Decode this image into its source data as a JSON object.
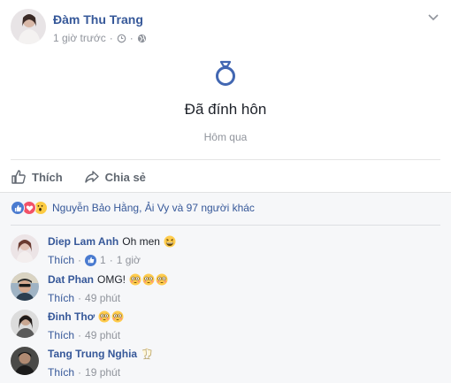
{
  "post": {
    "author": "Đàm Thu Trang",
    "time": "1 giờ trước",
    "time_separator": "·",
    "event_title": "Đã đính hôn",
    "event_date": "Hôm qua"
  },
  "actions": {
    "like_label": "Thích",
    "share_label": "Chia sẻ"
  },
  "reactions": {
    "summary": "Nguyễn Bảo Hằng, Ải Vy và 97 người khác",
    "types": [
      "like",
      "love",
      "wow"
    ]
  },
  "comments": [
    {
      "name": "Diep Lam Anh",
      "text": "Oh men",
      "emoji": [
        "grinning-squint"
      ],
      "like_label": "Thích",
      "like_count": "1",
      "sep": "·",
      "time": "1 giờ"
    },
    {
      "name": "Dat Phan",
      "text": "OMG!",
      "emoji": [
        "flushed",
        "flushed",
        "flushed"
      ],
      "like_label": "Thích",
      "sep": "·",
      "time": "49 phút"
    },
    {
      "name": "Đinh Thơ",
      "text": "",
      "emoji": [
        "flushed",
        "flushed"
      ],
      "like_label": "Thích",
      "sep": "·",
      "time": "49 phút"
    },
    {
      "name": "Tang Trung Nghia",
      "text": "",
      "emoji": [
        "clinking-glasses"
      ],
      "like_label": "Thích",
      "sep": "·",
      "time": "19 phút"
    }
  ],
  "colors": {
    "link_blue": "#365899",
    "meta_gray": "#90949c",
    "like_blue": "#4a7bd0",
    "love_red": "#f25268",
    "wow_yellow": "#fccb43",
    "feedback_bg": "#f6f7f9"
  },
  "icons": [
    "ring-icon",
    "clock-icon",
    "globe-icon",
    "chevron-down-icon",
    "like-icon",
    "share-icon"
  ]
}
